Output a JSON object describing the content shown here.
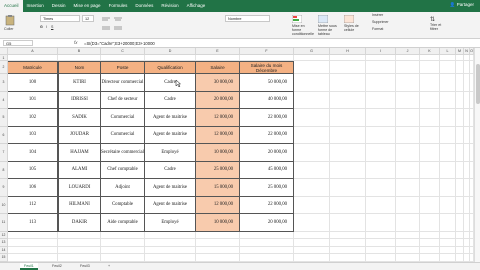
{
  "ribbon": {
    "tabs": [
      "Accueil",
      "Insertion",
      "Dessin",
      "Mise en page",
      "Formules",
      "Données",
      "Révision",
      "Affichage"
    ],
    "active_tab": "Accueil",
    "share_label": "Partager",
    "paste_label": "Coller",
    "font_name": "Times",
    "font_size": "12",
    "number_format": "Nombre",
    "insert_label": "Insérer",
    "delete_label": "Supprimer",
    "format_label": "Format",
    "conditional_label": "Mise en forme conditionnelle",
    "table_label": "Mettre sous forme de tableau",
    "styles_label": "Styles de cellule",
    "sort_label": "Trier et filtrer"
  },
  "formula_bar": {
    "name_box": "G5",
    "fx": "fx",
    "formula": "=SI(D3=\"Cadre\";E3+20000;E3+10000"
  },
  "columns": [
    "A",
    "B",
    "C",
    "D",
    "E",
    "F",
    "G",
    "H",
    "I",
    "J",
    "K",
    "L",
    "M",
    "N",
    "O",
    "P"
  ],
  "table": {
    "headers": [
      "Matricule",
      "Nom",
      "Poste",
      "Qualification",
      "Salaire",
      "Salaire du mois Décembre"
    ],
    "rows": [
      [
        "100",
        "KTIRI",
        "Directeur commercial",
        "Cadre",
        "30 000,00",
        "50 000,00"
      ],
      [
        "101",
        "IDRISSI",
        "Chef de secteur",
        "Cadre",
        "20 000,00",
        "40 000,00"
      ],
      [
        "102",
        "SADIK",
        "Commercial",
        "Agent de maitrise",
        "12 000,00",
        "22 000,00"
      ],
      [
        "103",
        "JOUDAR",
        "Commercial",
        "Agent de maitrise",
        "12 000,00",
        "22 000,00"
      ],
      [
        "104",
        "HAJJAM",
        "Secrétaire commercial",
        "Employé",
        "10 000,00",
        "20 000,00"
      ],
      [
        "105",
        "ALAMI",
        "Chef comptable",
        "Cadre",
        "25 000,00",
        "45 000,00"
      ],
      [
        "106",
        "LOUARDI",
        "Adjoint",
        "Agent de maitrise",
        "15 000,00",
        "25 000,00"
      ],
      [
        "112",
        "HILMANI",
        "Comptable",
        "Agent de maitrise",
        "12 000,00",
        "22 000,00"
      ],
      [
        "113",
        "DAKIR",
        "Aide comptable",
        "Employé",
        "10 000,00",
        "20 000,00"
      ]
    ]
  },
  "row_numbers": [
    "1",
    "2",
    "3",
    "4",
    "5",
    "6",
    "7",
    "8",
    "9",
    "10",
    "11",
    "12",
    "13",
    "14",
    "15",
    "16",
    "17",
    "18",
    "19",
    "20",
    "21",
    "22",
    "23",
    "24"
  ],
  "sheet_tabs": [
    "Feuil1",
    "Feuil2",
    "Feuil3"
  ],
  "colors": {
    "excel_green": "#217346",
    "header_fill": "#f4b183",
    "salary_fill": "#f8cbad"
  }
}
